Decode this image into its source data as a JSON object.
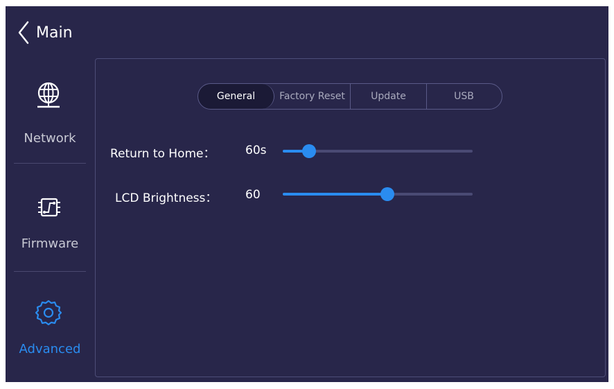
{
  "header": {
    "back_label": "Main"
  },
  "sidebar": {
    "items": [
      {
        "label": "Network",
        "icon": "globe-network-icon",
        "active": false
      },
      {
        "label": "Firmware",
        "icon": "circuit-board-icon",
        "active": false
      },
      {
        "label": "Advanced",
        "icon": "gear-icon",
        "active": true
      }
    ]
  },
  "tabs": [
    {
      "label": "General",
      "active": true
    },
    {
      "label": "Factory Reset",
      "active": false
    },
    {
      "label": "Update",
      "active": false
    },
    {
      "label": "USB",
      "active": false
    }
  ],
  "settings": {
    "return_home": {
      "label": "Return to Home：",
      "value": "60s",
      "slider_fraction": 0.14
    },
    "lcd_brightness": {
      "label": "LCD Brightness：",
      "value": "60",
      "slider_fraction": 0.55
    }
  },
  "colors": {
    "accent": "#2a8cf0",
    "background": "#28264a",
    "text": "#ffffff",
    "muted": "#c8c9d4"
  }
}
